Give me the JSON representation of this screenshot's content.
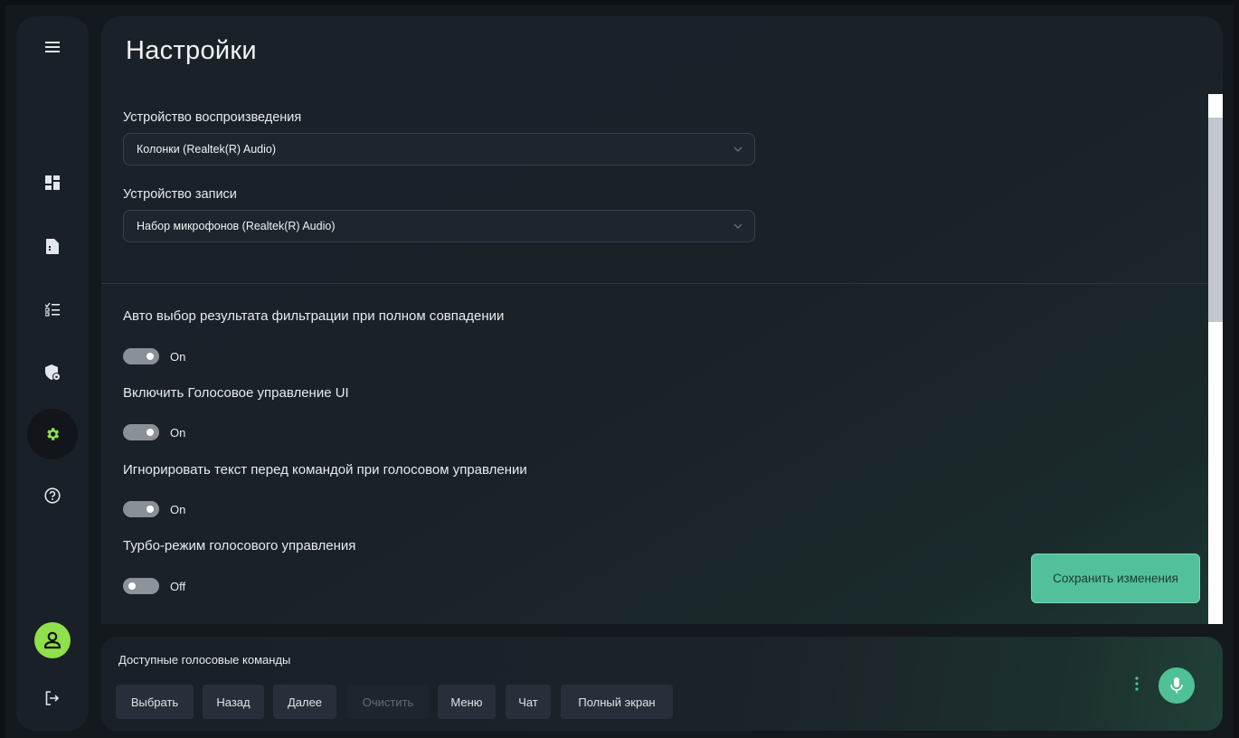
{
  "page": {
    "title": "Настройки"
  },
  "sidebar": {
    "items": [
      {
        "icon": "menu-icon"
      },
      {
        "icon": "dashboard-icon"
      },
      {
        "icon": "document-icon"
      },
      {
        "icon": "checklist-icon"
      },
      {
        "icon": "shield-lock-icon"
      },
      {
        "icon": "gear-icon",
        "active": true
      },
      {
        "icon": "help-icon"
      },
      {
        "icon": "user-icon"
      },
      {
        "icon": "logout-icon"
      }
    ],
    "accent": "#8fe04a"
  },
  "settings": {
    "playback": {
      "label": "Устройство воспроизведения",
      "value": "Колонки (Realtek(R) Audio)"
    },
    "recording": {
      "label": "Устройство записи",
      "value": "Набор микрофонов (Realtek(R) Audio)"
    },
    "options": [
      {
        "label": "Авто выбор результата фильтрации при полном совпадении",
        "state": "On"
      },
      {
        "label": "Включить Голосовое управление UI",
        "state": "On"
      },
      {
        "label": "Игнорировать текст перед командой при голосовом управлении",
        "state": "On"
      },
      {
        "label": "Турбо-режим голосового управления",
        "state": "Off"
      }
    ],
    "save_label": "Сохранить изменения",
    "save_color": "#52c19b"
  },
  "voice": {
    "title": "Доступные голосовые команды",
    "commands": [
      {
        "label": "Выбрать",
        "enabled": true
      },
      {
        "label": "Назад",
        "enabled": true
      },
      {
        "label": "Далее",
        "enabled": true
      },
      {
        "label": "Очистить",
        "enabled": false
      },
      {
        "label": "Меню",
        "enabled": true
      },
      {
        "label": "Чат",
        "enabled": true
      },
      {
        "label": "Полный экран",
        "enabled": true
      }
    ],
    "mic_color": "#4ec197"
  }
}
